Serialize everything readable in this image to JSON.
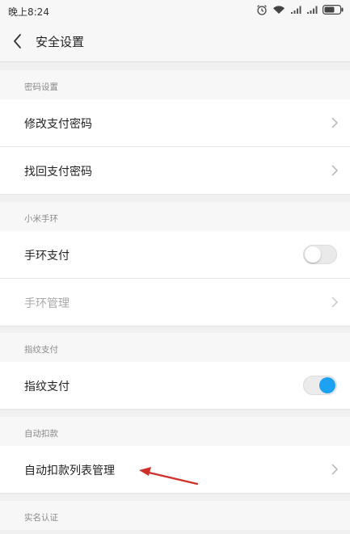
{
  "status_bar": {
    "time": "晚上8:24",
    "icons": [
      "alarm-icon",
      "wifi-icon",
      "signal-icon",
      "signal-icon",
      "battery-icon"
    ]
  },
  "header": {
    "title": "安全设置",
    "back_icon": "back-chevron-icon"
  },
  "sections": [
    {
      "header": "密码设置",
      "items": [
        {
          "label": "修改支付密码",
          "control": "chevron"
        },
        {
          "label": "找回支付密码",
          "control": "chevron"
        }
      ]
    },
    {
      "header": "小米手环",
      "items": [
        {
          "label": "手环支付",
          "control": "toggle",
          "state": "off"
        },
        {
          "label": "手环管理",
          "control": "chevron",
          "disabled": true
        }
      ]
    },
    {
      "header": "指纹支付",
      "items": [
        {
          "label": "指纹支付",
          "control": "toggle",
          "state": "on"
        }
      ]
    },
    {
      "header": "自动扣款",
      "items": [
        {
          "label": "自动扣款列表管理",
          "control": "chevron"
        }
      ]
    },
    {
      "header": "实名认证",
      "items": []
    }
  ],
  "colors": {
    "toggle_on_knob": "#1da1f2",
    "annotation_arrow": "#d0302a",
    "background": "#f0f0f0"
  }
}
